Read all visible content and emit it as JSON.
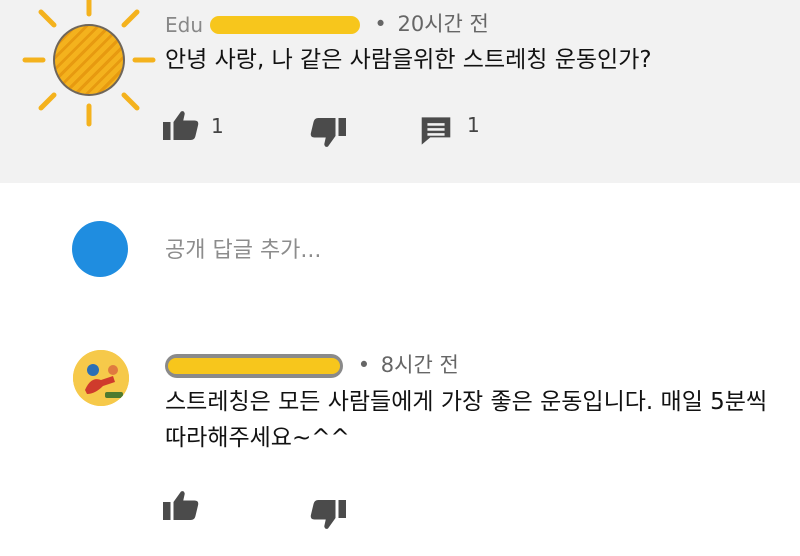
{
  "comment1": {
    "author_visible": "Edu",
    "time": "20시간 전",
    "text": "안녕 사랑, 나 같은 사람을위한 스트레칭 운동인가?",
    "likes": "1",
    "replies": "1"
  },
  "reply_box": {
    "placeholder": "공개 답글 추가..."
  },
  "comment2": {
    "time": "8시간 전",
    "text": "스트레칭은 모든 사람들에게 가장 좋은 운동입니다. 매일 5분씩 따라해주세요~^^"
  },
  "colors": {
    "redaction": "#f7c61c",
    "reply_avatar": "#1f8de0",
    "top_background": "#f2f2f2"
  },
  "icons": [
    "like-icon",
    "dislike-icon",
    "reply-icon"
  ]
}
